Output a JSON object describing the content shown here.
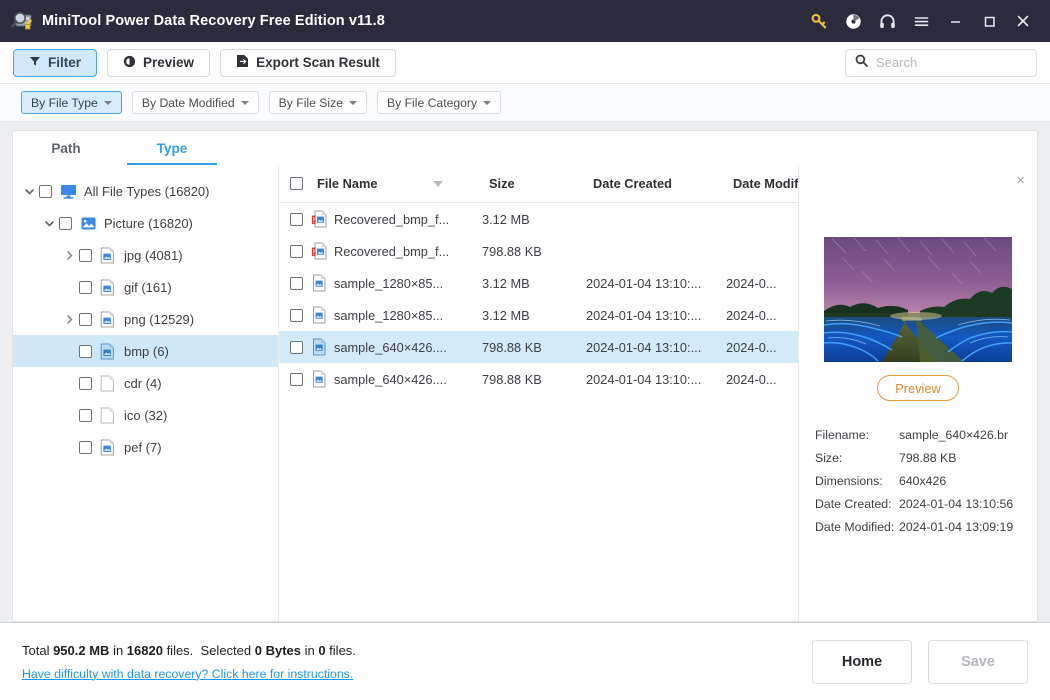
{
  "window": {
    "title": "MiniTool Power Data Recovery Free Edition v11.8",
    "app_icon": "disk-magnifier-icon",
    "controls": [
      {
        "name": "key-icon",
        "glyph": "key"
      },
      {
        "name": "disc-icon",
        "glyph": "disc"
      },
      {
        "name": "headphones-icon",
        "glyph": "headphones"
      },
      {
        "name": "menu-icon",
        "glyph": "hamburger"
      },
      {
        "name": "minimize-button",
        "glyph": "minimize"
      },
      {
        "name": "maximize-button",
        "glyph": "maximize"
      },
      {
        "name": "close-button",
        "glyph": "close"
      }
    ]
  },
  "toolbar": {
    "filter_label": "Filter",
    "preview_label": "Preview",
    "export_label": "Export Scan Result",
    "search_placeholder": "Search",
    "search_value": ""
  },
  "filterbar": {
    "items": [
      {
        "label": "By File Type",
        "active": true
      },
      {
        "label": "By Date Modified",
        "active": false
      },
      {
        "label": "By File Size",
        "active": false
      },
      {
        "label": "By File Category",
        "active": false
      }
    ]
  },
  "tabs": [
    {
      "label": "Path",
      "active": false
    },
    {
      "label": "Type",
      "active": true
    }
  ],
  "tree": {
    "nodes": [
      {
        "label": "All File Types (16820)",
        "indent": 0,
        "chevron": "down",
        "icon": "monitor-icon",
        "selected": false
      },
      {
        "label": "Picture (16820)",
        "indent": 1,
        "chevron": "down",
        "icon": "picture-icon",
        "selected": false
      },
      {
        "label": "jpg (4081)",
        "indent": 2,
        "chevron": "right",
        "icon": "image-file-icon",
        "selected": false
      },
      {
        "label": "gif (161)",
        "indent": 3,
        "chevron": "none",
        "icon": "image-file-icon",
        "selected": false
      },
      {
        "label": "png (12529)",
        "indent": 2,
        "chevron": "right",
        "icon": "image-file-icon",
        "selected": false
      },
      {
        "label": "bmp (6)",
        "indent": 3,
        "chevron": "none",
        "icon": "image-file-icon-active",
        "selected": true
      },
      {
        "label": "cdr (4)",
        "indent": 3,
        "chevron": "none",
        "icon": "blank-file-icon",
        "selected": false
      },
      {
        "label": "ico (32)",
        "indent": 3,
        "chevron": "none",
        "icon": "blank-file-icon",
        "selected": false
      },
      {
        "label": "pef (7)",
        "indent": 3,
        "chevron": "none",
        "icon": "image-file-icon",
        "selected": false
      }
    ]
  },
  "filelist": {
    "columns": [
      "File Name",
      "Size",
      "Date Created",
      "Date Modifie"
    ],
    "sort_column": "File Name",
    "sort_direction": "desc",
    "rows": [
      {
        "name": "Recovered_bmp_f...",
        "size": "3.12 MB",
        "date_created": "",
        "date_modified": "",
        "icon": "recovered-image-file-icon",
        "selected": false
      },
      {
        "name": "Recovered_bmp_f...",
        "size": "798.88 KB",
        "date_created": "",
        "date_modified": "",
        "icon": "recovered-image-file-icon",
        "selected": false
      },
      {
        "name": "sample_1280×85...",
        "size": "3.12 MB",
        "date_created": "2024-01-04 13:10:...",
        "date_modified": "2024-0...",
        "icon": "image-file-icon",
        "selected": false
      },
      {
        "name": "sample_1280×85...",
        "size": "3.12 MB",
        "date_created": "2024-01-04 13:10:...",
        "date_modified": "2024-0...",
        "icon": "image-file-icon",
        "selected": false
      },
      {
        "name": "sample_640×426....",
        "size": "798.88 KB",
        "date_created": "2024-01-04 13:10:...",
        "date_modified": "2024-0...",
        "icon": "image-file-icon-active",
        "selected": true
      },
      {
        "name": "sample_640×426....",
        "size": "798.88 KB",
        "date_created": "2024-01-04 13:10:...",
        "date_modified": "2024-0...",
        "icon": "image-file-icon",
        "selected": false
      }
    ]
  },
  "preview": {
    "close_glyph": "×",
    "image_alt": "bioluminescent-field-night-landscape",
    "button_label": "Preview",
    "meta": [
      {
        "key": "Filename:",
        "value": "sample_640×426.br"
      },
      {
        "key": "Size:",
        "value": "798.88 KB"
      },
      {
        "key": "Dimensions:",
        "value": "640x426"
      },
      {
        "key": "Date Created:",
        "value": "2024-01-04 13:10:56"
      },
      {
        "key": "Date Modified:",
        "value": "2024-01-04 13:09:19"
      }
    ]
  },
  "footer": {
    "total_prefix": "Total ",
    "total_size": "950.2 MB",
    "total_mid": " in ",
    "total_count": "16820",
    "total_suffix": " files.",
    "selected_prefix": "Selected ",
    "selected_size": "0 Bytes",
    "selected_mid": " in ",
    "selected_count": "0",
    "selected_suffix": " files.",
    "help_link": "Have difficulty with data recovery? Click here for instructions.",
    "home_label": "Home",
    "save_label": "Save"
  },
  "colors": {
    "titlebar": "#2b2b3d",
    "accent_blue": "#2f9fe8",
    "selection": "#d3eaf9",
    "preview_orange": "#e8862a",
    "link": "#2196f3"
  }
}
